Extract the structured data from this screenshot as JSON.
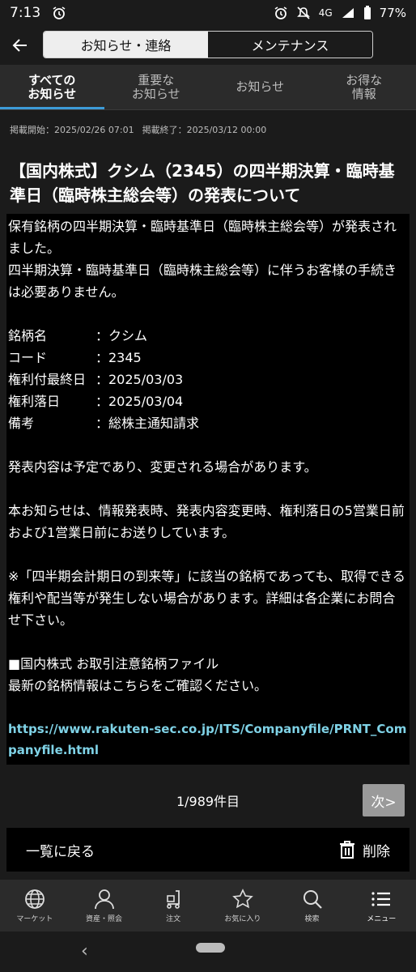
{
  "status": {
    "time": "7:13",
    "network": "4G",
    "battery": "77%"
  },
  "header": {
    "segments": [
      "お知らせ・連絡",
      "メンテナンス"
    ]
  },
  "tabs": [
    {
      "label": "すべての\nお知らせ"
    },
    {
      "label": "重要な\nお知らせ"
    },
    {
      "label": "お知らせ"
    },
    {
      "label": "お得な\n情報"
    }
  ],
  "meta": {
    "start": "掲載開始：2025/02/26 07:01",
    "end": "掲載終了：2025/03/12 00:00"
  },
  "title": "【国内株式】クシム（2345）の四半期決算・臨時基準日（臨時株主総会等）の発表について",
  "body": {
    "p1": "保有銘柄の四半期決算・臨時基準日（臨時株主総会等）が発表されました。",
    "p2": "四半期決算・臨時基準日（臨時株主総会等）に伴うお客様の手続きは必要ありません。",
    "details": [
      {
        "k": "銘柄名",
        "v": "：クシム"
      },
      {
        "k": "コード",
        "v": "：2345"
      },
      {
        "k": "権利付最終日",
        "v": "：2025/03/03"
      },
      {
        "k": "権利落日",
        "v": "：2025/03/04"
      },
      {
        "k": "備考",
        "v": "：総株主通知請求"
      }
    ],
    "p3": "発表内容は予定であり、変更される場合があります。",
    "p4": "本お知らせは、情報発表時、発表内容変更時、権利落日の5営業日前および1営業日前にお送りしています。",
    "p5": "※「四半期会計期日の到来等」に該当の銘柄であっても、取得できる権利や配当等が発生しない場合があります。詳細は各企業にお問合せ下さい。",
    "p6": "■国内株式 お取引注意銘柄ファイル",
    "p7": "最新の銘柄情報はこちらをご確認ください。",
    "link": "https://www.rakuten-sec.co.jp/ITS/Companyfile/PRNT_Companyfile.html"
  },
  "pager": {
    "count": "1/989件目",
    "next": "次>"
  },
  "actions": {
    "back": "一覧に戻る",
    "delete": "削除"
  },
  "nav": [
    {
      "label": "マーケット",
      "icon": "globe-icon"
    },
    {
      "label": "資産・照会",
      "icon": "person-icon"
    },
    {
      "label": "注文",
      "icon": "cart-icon"
    },
    {
      "label": "お気に入り",
      "icon": "star-icon"
    },
    {
      "label": "検索",
      "icon": "search-icon"
    },
    {
      "label": "メニュー",
      "icon": "menu-icon"
    }
  ]
}
